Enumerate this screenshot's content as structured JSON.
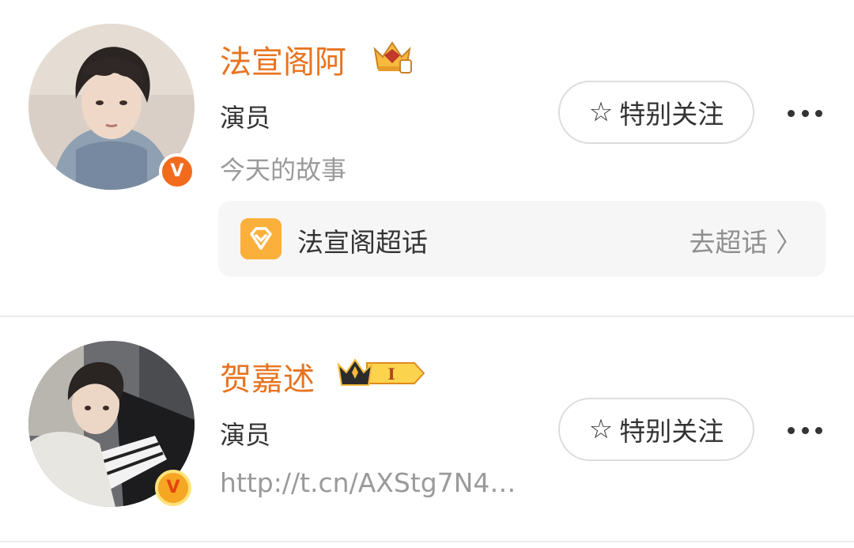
{
  "users": [
    {
      "name": "法宣阁阿",
      "role": "演员",
      "bio": "今天的故事",
      "follow_label": "特别关注",
      "topic": {
        "name": "法宣阁超话",
        "go_label": "去超话 〉"
      }
    },
    {
      "name": "贺嘉述",
      "role": "演员",
      "bio": "http://t.cn/AXStg7N4…",
      "follow_label": "特别关注",
      "badge_label": "I"
    }
  ],
  "colors": {
    "name": "#e8731f",
    "verified": "#f26b1d",
    "topic_icon": "#fbb03b"
  },
  "icons": {
    "verified": "v-verified-icon",
    "follow": "star-outline-icon",
    "more": "more-dots-icon",
    "crown": "crown-icon",
    "topic": "diamond-icon"
  },
  "verified_glyph": "V"
}
